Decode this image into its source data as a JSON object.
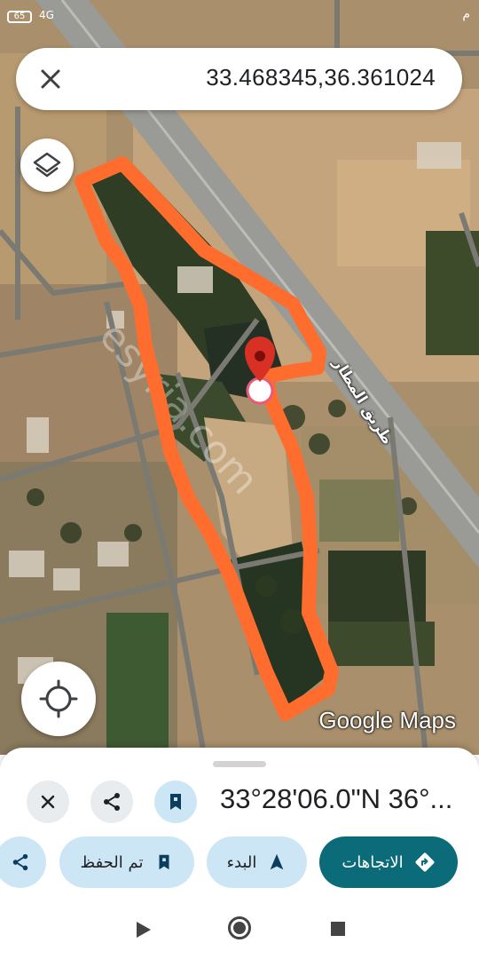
{
  "status_bar": {
    "battery": "65",
    "signal": "4G",
    "right_text": "م"
  },
  "search": {
    "query": "33.468345,36.361024"
  },
  "map": {
    "street_label": "طريق المطار",
    "watermark": "esyria.com",
    "attribution": "Google Maps",
    "outline_color": "#ff6d2e",
    "pin_color": "#d93025"
  },
  "place": {
    "coordinates_dms": "33°28'06.0\"N 36°..."
  },
  "actions": {
    "saved_label": "تم الحفظ",
    "start_label": "البدء",
    "directions_label": "الاتجاهات"
  },
  "colors": {
    "accent": "#0b6b78",
    "chip": "#cde6f5"
  }
}
